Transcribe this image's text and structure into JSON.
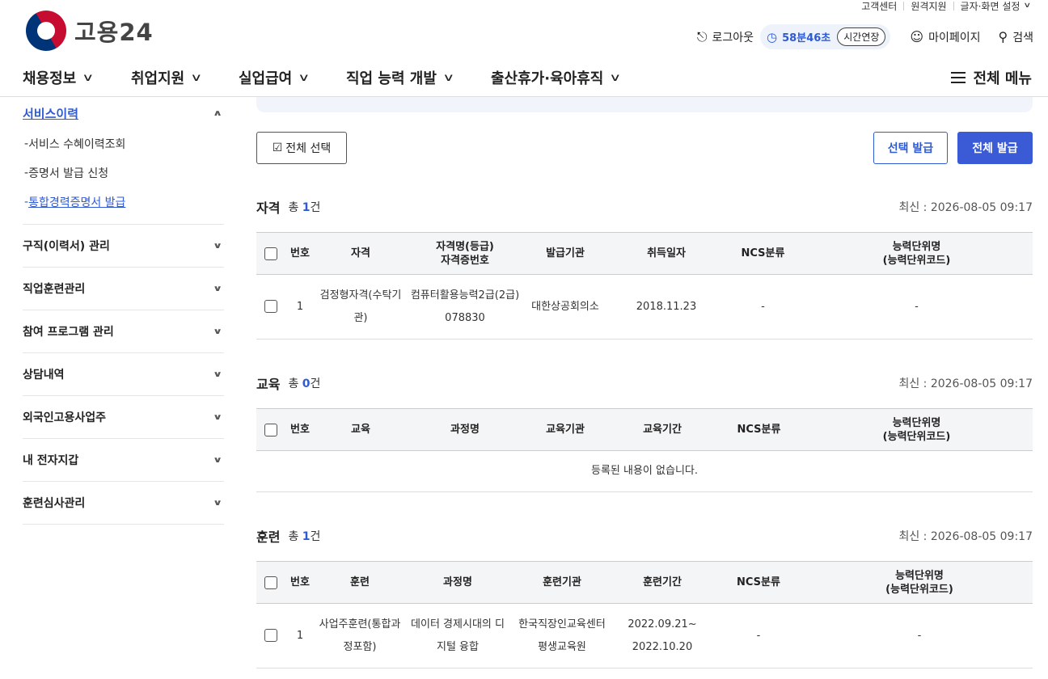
{
  "util": {
    "items": [
      "고객센터",
      "원격지원",
      "글자·화면 설정"
    ]
  },
  "logo": {
    "text": "고용24"
  },
  "header": {
    "logout": "로그아웃",
    "timer": "58분46초",
    "extend": "시간연장",
    "mypage": "마이페이지",
    "search": "검색"
  },
  "gnb": {
    "items": [
      "채용정보",
      "취업지원",
      "실업급여",
      "직업 능력 개발",
      "출산휴가·육아휴직"
    ],
    "all": "전체 메뉴"
  },
  "side": {
    "current": "서비스이력",
    "subs": [
      "서비스 수혜이력조회",
      "증명서 발급 신청",
      "통합경력증명서 발급"
    ],
    "items": [
      "구직(이력서) 관리",
      "직업훈련관리",
      "참여 프로그램 관리",
      "상담내역",
      "외국인고용사업주",
      "내 전자지갑",
      "훈련심사관리"
    ]
  },
  "buttons": {
    "select_all": "전체 선택",
    "select_issue": "선택 발급",
    "all_issue": "전체 발급"
  },
  "sections": {
    "cert": {
      "title": "자격",
      "total_pre": "총",
      "count": "1",
      "unit": "건",
      "updated": "최신 : 2026-08-05 09:17",
      "headers": [
        "번호",
        "자격",
        "자격명(등급)\n자격증번호",
        "발급기관",
        "취득일자",
        "NCS분류",
        "능력단위명\n(능력단위코드)"
      ],
      "rows": [
        {
          "no": "1",
          "type": "검정형자격(수탁기관)",
          "name": "컴퓨터활용능력2급(2급)",
          "num": "078830",
          "org": "대한상공회의소",
          "date": "2018.11.23",
          "ncs": "-",
          "unit": "-"
        }
      ]
    },
    "edu": {
      "title": "교육",
      "total_pre": "총",
      "count": "0",
      "unit": "건",
      "updated": "최신 : 2026-08-05 09:17",
      "headers": [
        "번호",
        "교육",
        "과정명",
        "교육기관",
        "교육기간",
        "NCS분류",
        "능력단위명\n(능력단위코드)"
      ],
      "empty": "등록된 내용이 없습니다."
    },
    "train": {
      "title": "훈련",
      "total_pre": "총",
      "count": "1",
      "unit": "건",
      "updated": "최신 : 2026-08-05 09:17",
      "headers": [
        "번호",
        "훈련",
        "과정명",
        "훈련기관",
        "훈련기간",
        "NCS분류",
        "능력단위명\n(능력단위코드)"
      ],
      "rows": [
        {
          "no": "1",
          "type1": "사업주훈련(통합과",
          "type2": "정포함)",
          "course1": "데이터 경제시대의 디",
          "course2": "지털 융합",
          "org1": "한국직장인교육센터",
          "org2": "평생교육원",
          "period1": "2022.09.21~",
          "period2": "2022.10.20",
          "ncs": "-",
          "unit": "-"
        }
      ]
    }
  }
}
